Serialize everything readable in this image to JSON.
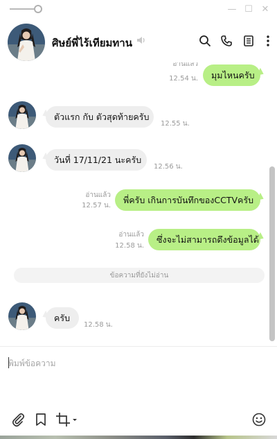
{
  "window": {
    "minimize_glyph": "—",
    "maximize_glyph": "☐",
    "close_glyph": "✕"
  },
  "header": {
    "title": "ศิษย์พี่ไร้เทียมทาน",
    "icons": [
      "search-icon",
      "phone-icon",
      "notes-icon",
      "more-icon"
    ]
  },
  "messages": [
    {
      "side": "out",
      "text": "มุมไหนครับ",
      "status": "อ่านแล้ว",
      "time": "12.54 น."
    },
    {
      "side": "in",
      "text": "ตัวแรก กับ ตัวสุดท้ายครับ",
      "time": "12.55 น."
    },
    {
      "side": "in",
      "text": "วันที่ 17/11/21 นะครับ",
      "time": "12.56 น."
    },
    {
      "side": "out",
      "text": "พี่ครับ เกินการบันทึกของCCTVครับ",
      "status": "อ่านแล้ว",
      "time": "12.57 น."
    },
    {
      "side": "out",
      "text": "ซึ่งจะไม่สามารถดึงข้อมูลได้",
      "status": "อ่านแล้ว",
      "time": "12.58 น."
    },
    {
      "side": "in",
      "text": "ครับ",
      "time": "12.58 น."
    }
  ],
  "unread_divider": "ข้อความที่ยังไม่อ่าน",
  "compose": {
    "placeholder": "พิมพ์ข้อความ",
    "tools": [
      "attach-icon",
      "bookmark-icon",
      "crop-icon",
      "emoji-icon"
    ]
  },
  "colors": {
    "outgoing_bubble": "#b8ef86",
    "incoming_bubble": "#eeeeee",
    "meta_text": "#9a9a9a"
  }
}
